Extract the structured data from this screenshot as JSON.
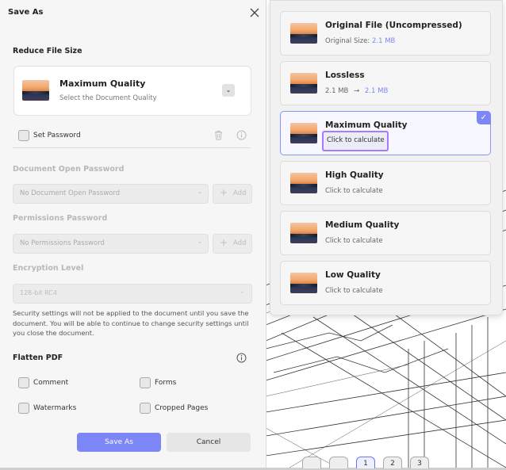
{
  "dialog": {
    "title": "Save As",
    "reduce_label": "Reduce File Size",
    "quality": {
      "title": "Maximum Quality",
      "subtitle": "Select the Document Quality"
    },
    "set_password_label": "Set Password",
    "open_password_label": "Document Open Password",
    "open_password_value": "No Document Open Password",
    "permissions_label": "Permissions Password",
    "permissions_value": "No Permissions Password",
    "add_label": "Add",
    "encryption_label": "Encryption Level",
    "encryption_value": "128-bit RC4",
    "note": "Security settings will not be applied to the document until you save the document. You will be able to continue to change security settings until you close the document.",
    "flatten_label": "Flatten PDF",
    "flatten_options": [
      "Comment",
      "Forms",
      "Watermarks",
      "Cropped Pages"
    ],
    "save_label": "Save As",
    "cancel_label": "Cancel"
  },
  "popup": {
    "options": [
      {
        "title": "Original File (Uncompressed)",
        "sub_prefix": "Original Size: ",
        "sub_accent": "2.1 MB"
      },
      {
        "title": "Lossless",
        "from": "2.1 MB",
        "arrow": "→",
        "to": "2.1 MB"
      },
      {
        "title": "Maximum Quality",
        "sub": "Click to calculate",
        "selected": true
      },
      {
        "title": "High Quality",
        "sub": "Click to calculate"
      },
      {
        "title": "Medium Quality",
        "sub": "Click to calculate"
      },
      {
        "title": "Low Quality",
        "sub": "Click to calculate"
      }
    ],
    "check_glyph": "✓"
  },
  "toolbar": {
    "pages": [
      "1",
      "2",
      "3"
    ]
  },
  "colors": {
    "accent": "#7d86f7",
    "highlight": "#a77bff"
  }
}
